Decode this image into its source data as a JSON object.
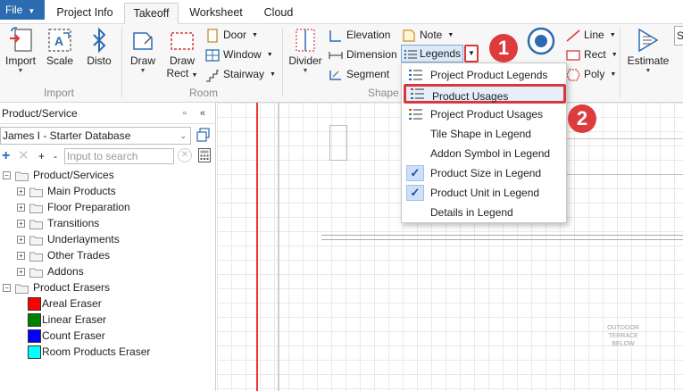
{
  "tabs": {
    "file": "File",
    "items": [
      "Project Info",
      "Takeoff",
      "Worksheet",
      "Cloud"
    ],
    "active": "Takeoff"
  },
  "ribbon": {
    "import_group": {
      "label": "Import",
      "import": "Import",
      "scale": "Scale",
      "disto": "Disto"
    },
    "room_group": {
      "label": "Room",
      "draw": "Draw",
      "draw_rect_line1": "Draw",
      "draw_rect_line2": "Rect",
      "door": "Door",
      "window": "Window",
      "stairway": "Stairway"
    },
    "shape_group": {
      "label": "Shape",
      "divider": "Divider",
      "elevation": "Elevation",
      "dimension": "Dimension",
      "segment": "Segment",
      "note": "Note",
      "legends": "Legends"
    },
    "draw_group": {
      "line": "Line",
      "rect": "Rect",
      "poly": "Poly"
    },
    "estimate": "Estimate",
    "search_cut": "S"
  },
  "badges": [
    "1",
    "2"
  ],
  "legends_menu": {
    "items": [
      {
        "label": "Project Product Legends",
        "icon": "legend-list-icon",
        "checked": false
      },
      {
        "label": "Product Usages",
        "icon": "usage-list-icon",
        "checked": false,
        "highlighted": true
      },
      {
        "label": "Project Product Usages",
        "icon": "usage-list-icon",
        "checked": false
      },
      {
        "label": "Tile Shape in Legend",
        "checked": false
      },
      {
        "label": "Addon Symbol in Legend",
        "checked": false
      },
      {
        "label": "Product Size in Legend",
        "checked": true
      },
      {
        "label": "Product Unit in Legend",
        "checked": true
      },
      {
        "label": "Details in Legend",
        "checked": false
      }
    ]
  },
  "panel": {
    "title": "Product/Service",
    "database": "James I - Starter Database",
    "search_placeholder": "Input to search",
    "add": "+",
    "remove": "✕",
    "expand": "+",
    "collapse": "-",
    "tree": {
      "root": "Product/Services",
      "children": [
        "Main Products",
        "Floor Preparation",
        "Transitions",
        "Underlayments",
        "Other Trades",
        "Addons"
      ],
      "erasers_root": "Product Erasers",
      "erasers": [
        {
          "label": "Areal Eraser",
          "color": "#ff0000"
        },
        {
          "label": "Linear Eraser",
          "color": "#008000"
        },
        {
          "label": "Count Eraser",
          "color": "#0000ff"
        },
        {
          "label": "Room Products Eraser",
          "color": "#00ffff"
        }
      ]
    }
  },
  "canvas": {
    "label_lines": [
      "OUTDOOR",
      "TERRACE",
      "BELOW"
    ]
  },
  "colors": {
    "accent": "#2b6cb0",
    "highlight_border": "#d9383a",
    "badge": "#de3b3d"
  }
}
